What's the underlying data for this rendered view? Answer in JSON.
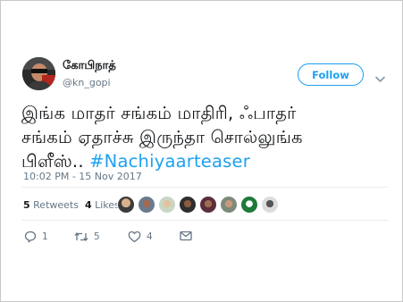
{
  "user": {
    "display_name": "கோபிநாத்",
    "handle": "@kn_gopi"
  },
  "follow_button": {
    "label": "Follow"
  },
  "tweet": {
    "text_line1": "இங்க மாதர் சங்கம் மாதிரி, ஃபாதர்",
    "text_line2": "சங்கம் ஏதாச்சு இருந்தா சொல்லுங்க",
    "text_line3": "பிளீஸ்.. ",
    "hashtag": "#Nachiyaarteaser",
    "timestamp": "10:02 PM - 15 Nov 2017"
  },
  "stats": {
    "retweets_count": "5",
    "retweets_label": "Retweets",
    "likes_count": "4",
    "likes_label": "Likes"
  },
  "actions": {
    "reply_count": "1",
    "retweet_count": "5",
    "like_count": "4"
  },
  "colors": {
    "accent": "#1da1f2",
    "secondary_text": "#657786"
  }
}
